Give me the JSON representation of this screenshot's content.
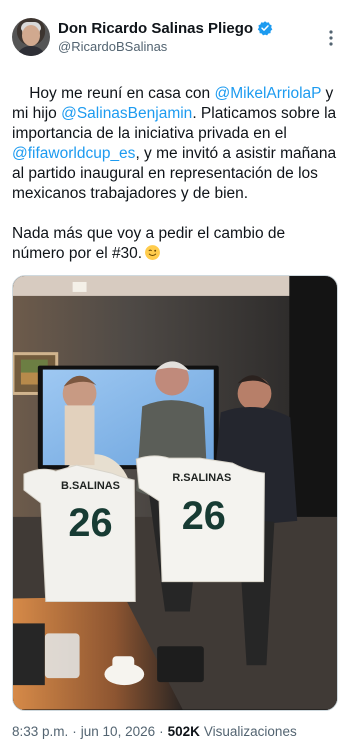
{
  "author": {
    "display_name": "Don Ricardo Salinas Pliego",
    "handle": "@RicardoBSalinas",
    "verified_icon": "verified-badge-icon",
    "avatar_icon": "profile-avatar"
  },
  "tweet": {
    "segments": [
      {
        "text": "Hoy me reuní en casa con ",
        "kind": "text"
      },
      {
        "text": "@MikelArriolaP",
        "kind": "mention"
      },
      {
        "text": " y mi hijo ",
        "kind": "text"
      },
      {
        "text": "@SalinasBenjamin",
        "kind": "mention"
      },
      {
        "text": ". Platicamos sobre la importancia de la iniciativa privada en el ",
        "kind": "text"
      },
      {
        "text": "@fifaworldcup_es",
        "kind": "mention"
      },
      {
        "text": ", y me invitó a asistir mañana al partido inaugural en representación de los mexicanos trabajadores y de bien.\n\nNada más que voy a pedir el cambio de número por el #30.",
        "kind": "text"
      }
    ],
    "emoji": "wink-emoji"
  },
  "media": {
    "jersey_left": "B.SALINAS",
    "jersey_right": "R.SALINAS",
    "jersey_number": "26"
  },
  "meta": {
    "time": "8:33 p.m.",
    "separator": "·",
    "date": "jun 10, 2026",
    "views_count": "502K",
    "views_label": "Visualizaciones"
  },
  "colors": {
    "link": "#1d9bf0",
    "text": "#0f1419",
    "secondary": "#536471",
    "verified": "#1d9bf0"
  }
}
